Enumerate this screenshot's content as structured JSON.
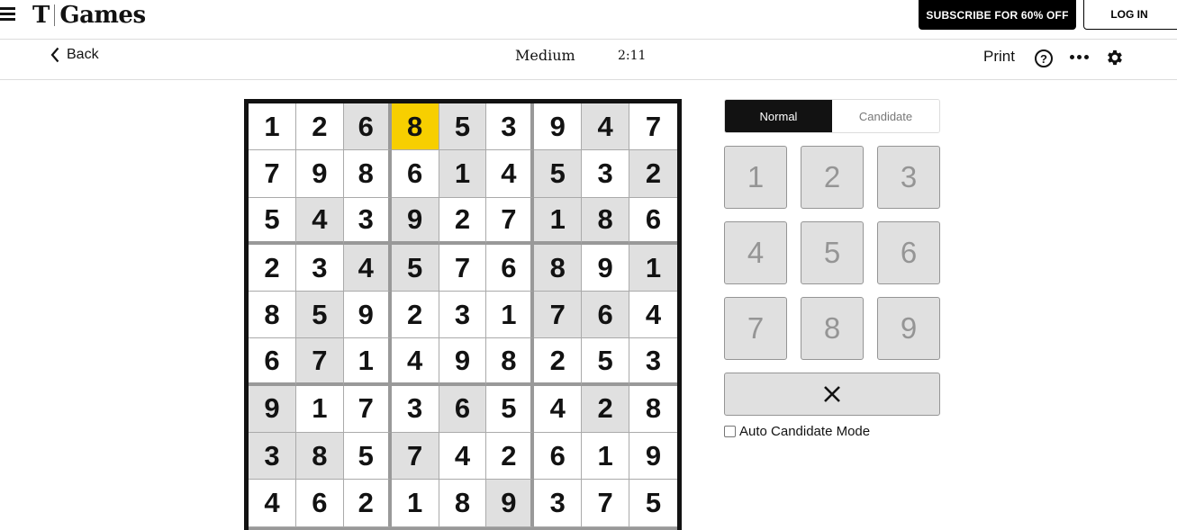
{
  "header": {
    "logo_mark": "T",
    "logo_text": "Games",
    "subscribe_label": "SUBSCRIBE FOR 60% OFF",
    "login_label": "LOG IN"
  },
  "toolbar": {
    "back_label": "Back",
    "difficulty": "Medium",
    "timer": "2:11",
    "print_label": "Print",
    "help_label": "?"
  },
  "board": {
    "selected": [
      0,
      3
    ],
    "highlight_color": "#f7cf00",
    "rows": [
      [
        1,
        2,
        6,
        8,
        5,
        3,
        9,
        4,
        7
      ],
      [
        7,
        9,
        8,
        6,
        1,
        4,
        5,
        3,
        2
      ],
      [
        5,
        4,
        3,
        9,
        2,
        7,
        1,
        8,
        6
      ],
      [
        2,
        3,
        4,
        5,
        7,
        6,
        8,
        9,
        1
      ],
      [
        8,
        5,
        9,
        2,
        3,
        1,
        7,
        6,
        4
      ],
      [
        6,
        7,
        1,
        4,
        9,
        8,
        2,
        5,
        3
      ],
      [
        9,
        1,
        7,
        3,
        6,
        5,
        4,
        2,
        8
      ],
      [
        3,
        8,
        5,
        7,
        4,
        2,
        6,
        1,
        9
      ],
      [
        4,
        6,
        2,
        1,
        8,
        9,
        3,
        7,
        5
      ]
    ],
    "given": [
      [
        0,
        0,
        1,
        0,
        1,
        0,
        0,
        1,
        0
      ],
      [
        0,
        0,
        0,
        0,
        1,
        0,
        1,
        0,
        1
      ],
      [
        0,
        1,
        0,
        1,
        0,
        0,
        1,
        1,
        0
      ],
      [
        0,
        0,
        1,
        1,
        0,
        0,
        1,
        0,
        1
      ],
      [
        0,
        1,
        0,
        0,
        0,
        0,
        1,
        1,
        0
      ],
      [
        0,
        1,
        0,
        0,
        0,
        0,
        0,
        0,
        0
      ],
      [
        1,
        0,
        0,
        0,
        1,
        0,
        0,
        1,
        0
      ],
      [
        1,
        1,
        0,
        1,
        0,
        0,
        0,
        0,
        0
      ],
      [
        0,
        0,
        0,
        0,
        0,
        1,
        0,
        0,
        0
      ]
    ]
  },
  "panel": {
    "modes": [
      {
        "label": "Normal",
        "active": true
      },
      {
        "label": "Candidate",
        "active": false
      }
    ],
    "keys": [
      "1",
      "2",
      "3",
      "4",
      "5",
      "6",
      "7",
      "8",
      "9"
    ],
    "auto_candidate_label": "Auto Candidate Mode",
    "auto_candidate_checked": false
  }
}
